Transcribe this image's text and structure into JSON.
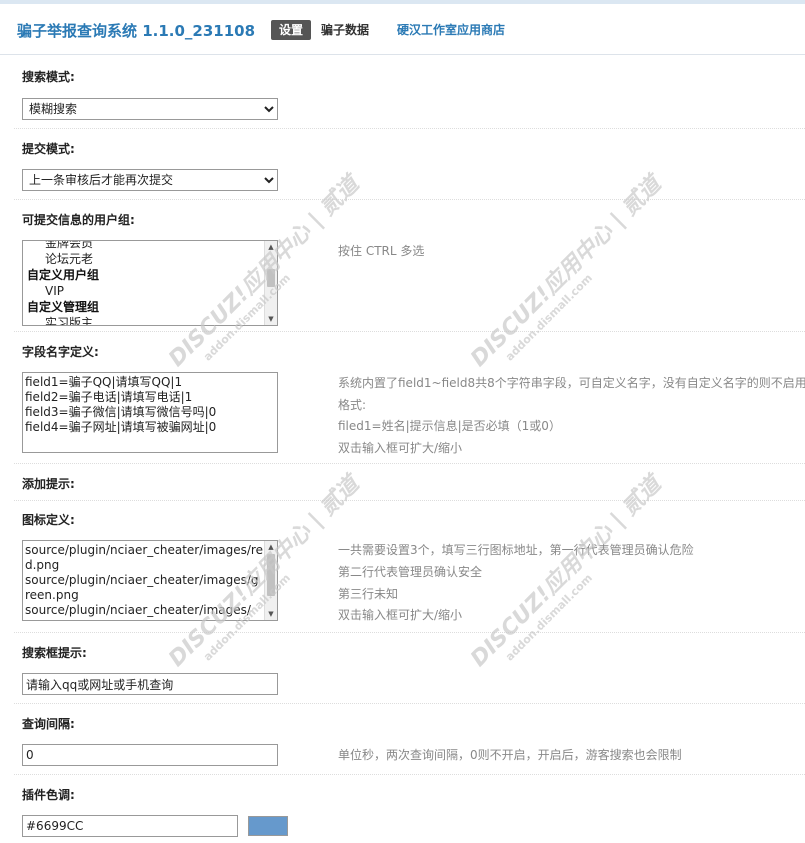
{
  "header": {
    "app_title": "骗子举报查询系统 1.1.0_231108",
    "nav": {
      "settings": "设置",
      "data": "骗子数据",
      "store": "硬汉工作室应用商店"
    }
  },
  "search_mode": {
    "label": "搜索模式:",
    "value": "模糊搜索"
  },
  "submit_mode": {
    "label": "提交模式:",
    "value": "上一条审核后才能再次提交"
  },
  "user_groups": {
    "label": "可提交信息的用户组:",
    "items": [
      {
        "text": "金牌会员",
        "type": "option"
      },
      {
        "text": "论坛元老",
        "type": "option"
      },
      {
        "text": "自定义用户组",
        "type": "group"
      },
      {
        "text": "VIP",
        "type": "option"
      },
      {
        "text": "自定义管理组",
        "type": "group"
      },
      {
        "text": "实习版主",
        "type": "option"
      }
    ],
    "tip": "按住 CTRL 多选"
  },
  "field_names": {
    "label": "字段名字定义:",
    "value": "field1=骗子QQ|请填写QQ|1\nfield2=骗子电话|请填写电话|1\nfield3=骗子微信|请填写微信号吗|0\nfield4=骗子网址|请填写被骗网址|0",
    "tips": [
      "系统内置了field1~field8共8个字符串字段，可自定义名字，没有自定义名字的则不启用",
      "格式:",
      "filed1=姓名|提示信息|是否必填（1或0）",
      "双击输入框可扩大/缩小"
    ]
  },
  "add_tip": {
    "label": "添加提示:"
  },
  "icon_def": {
    "label": "图标定义:",
    "value": "source/plugin/nciaer_cheater/images/red.png\nsource/plugin/nciaer_cheater/images/green.png\nsource/plugin/nciaer_cheater/images/",
    "tips": [
      "一共需要设置3个，填写三行图标地址，第一行代表管理员确认危险",
      "第二行代表管理员确认安全",
      "第三行未知",
      "双击输入框可扩大/缩小"
    ]
  },
  "search_tip": {
    "label": "搜索框提示:",
    "value": "请输入qq或网址或手机查询"
  },
  "query_interval": {
    "label": "查询间隔:",
    "value": "0",
    "tip": "单位秒，两次查询间隔，0则不开启，开启后，游客搜索也会限制"
  },
  "plugin_color": {
    "label": "插件色调:",
    "value": "#6699CC",
    "swatch_color": "#6699CC"
  },
  "watermark": {
    "brand": "DISCUZ!应用中心 | 贰道",
    "url": "addon.dismall.com"
  }
}
